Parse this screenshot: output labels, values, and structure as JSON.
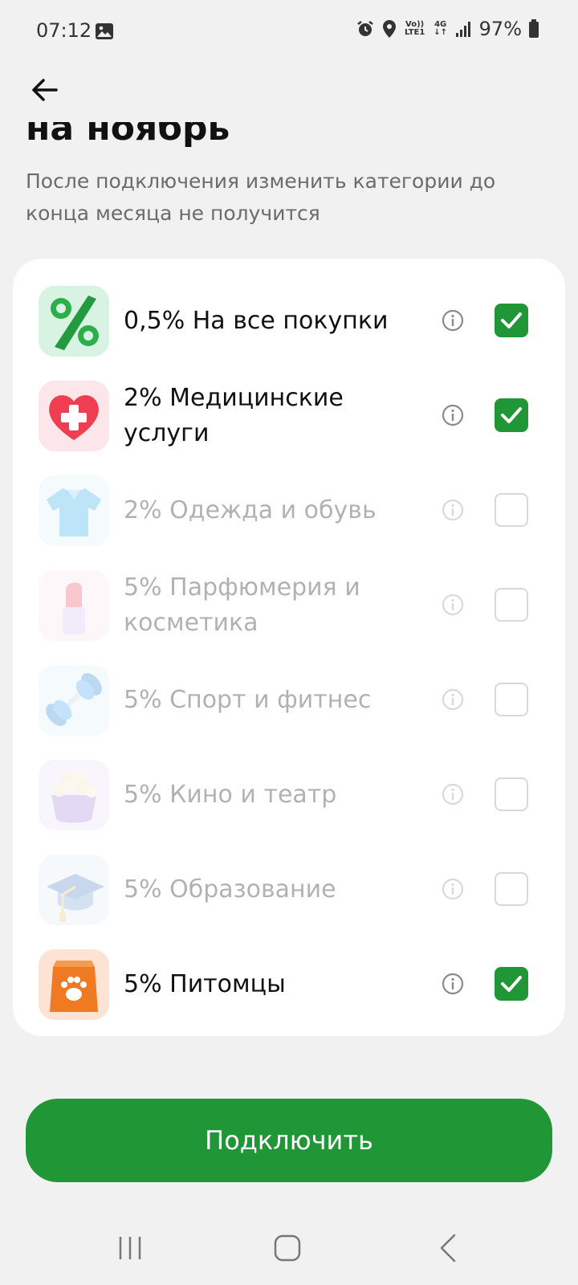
{
  "status_bar": {
    "time": "07:12",
    "network_top": "Vo))",
    "network_bottom": "LTE1",
    "data_type": "4G",
    "battery": "97%"
  },
  "header": {
    "title": "на ноябрь",
    "subtitle": "После подключения изменить категории до конца месяца не получится"
  },
  "categories": [
    {
      "label": "0,5% На все покупки",
      "icon": "percent-icon",
      "checked": true,
      "enabled": true
    },
    {
      "label": "2% Медицинские услуги",
      "icon": "heart-medical-icon",
      "checked": true,
      "enabled": true
    },
    {
      "label": "2% Одежда и обувь",
      "icon": "polo-shirt-icon",
      "checked": false,
      "enabled": false
    },
    {
      "label": "5% Парфюмерия и косметика",
      "icon": "lipstick-icon",
      "checked": false,
      "enabled": false
    },
    {
      "label": "5% Спорт и фитнес",
      "icon": "dumbbell-icon",
      "checked": false,
      "enabled": false
    },
    {
      "label": "5% Кино и театр",
      "icon": "popcorn-icon",
      "checked": false,
      "enabled": false
    },
    {
      "label": "5% Образование",
      "icon": "graduation-cap-icon",
      "checked": false,
      "enabled": false
    },
    {
      "label": "5% Питомцы",
      "icon": "pet-food-bag-icon",
      "checked": true,
      "enabled": true
    }
  ],
  "cta": {
    "label": "Подключить"
  },
  "colors": {
    "accent": "#219636",
    "background": "#f1f1f1",
    "card": "#ffffff"
  }
}
